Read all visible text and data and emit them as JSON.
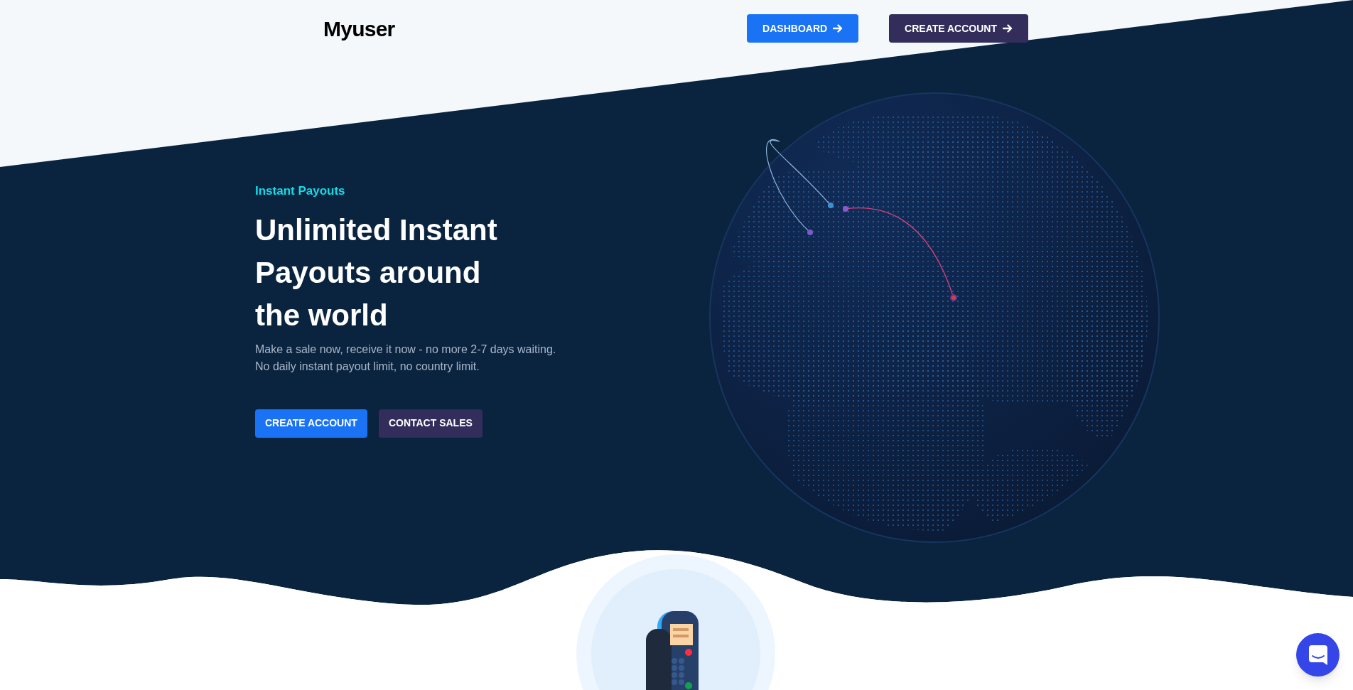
{
  "header": {
    "logo": "Myuser",
    "buttons": [
      {
        "label": "DASHBOARD",
        "kind": "primary"
      },
      {
        "label": "CREATE ACCOUNT",
        "kind": "secondary"
      }
    ]
  },
  "hero": {
    "eyebrow": "Instant Payouts",
    "title": "Unlimited Instant Payouts around the world",
    "description": [
      "Make a sale now, receive it now - no more 2-7 days waiting.",
      "No daily instant payout limit, no country limit."
    ],
    "buttons": [
      {
        "label": "CREATE ACCOUNT",
        "kind": "primary"
      },
      {
        "label": "CONTACT SALES",
        "kind": "secondary"
      }
    ]
  }
}
